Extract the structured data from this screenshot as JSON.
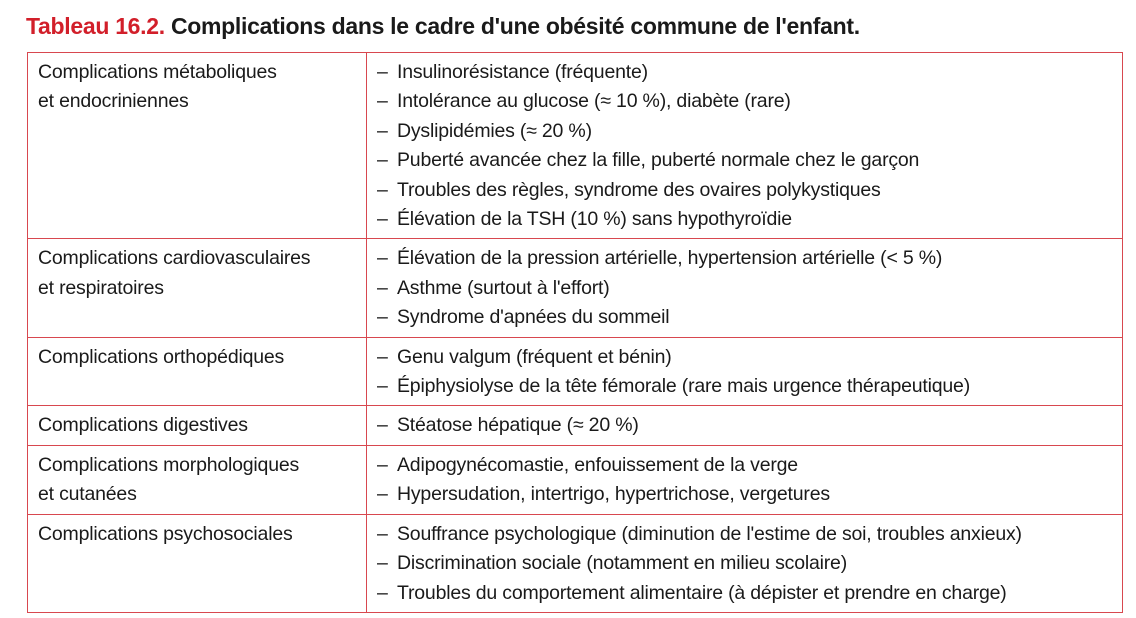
{
  "title": {
    "number": "Tableau 16.2.",
    "text": "Complications dans le cadre d'une obésité commune de l'enfant."
  },
  "bullet": "–",
  "colors": {
    "accent": "#d21f2a",
    "border": "#d8484f",
    "text": "#1a1a1a"
  },
  "rows": [
    {
      "category": [
        "Complications métaboliques",
        "et endocriniennes"
      ],
      "items": [
        "Insulinorésistance (fréquente)",
        "Intolérance au glucose (≈ 10 %), diabète (rare)",
        "Dyslipidémies (≈ 20 %)",
        "Puberté avancée chez la fille, puberté normale chez le garçon",
        "Troubles des règles, syndrome des ovaires polykystiques",
        "Élévation de la TSH (10 %) sans hypothyroïdie"
      ]
    },
    {
      "category": [
        "Complications cardiovasculaires",
        "et respiratoires"
      ],
      "items": [
        "Élévation de la pression artérielle, hypertension artérielle (< 5 %)",
        "Asthme (surtout à l'effort)",
        "Syndrome d'apnées du sommeil"
      ]
    },
    {
      "category": [
        "Complications orthopédiques"
      ],
      "items": [
        "Genu valgum (fréquent et bénin)",
        "Épiphysiolyse de la tête fémorale (rare mais urgence thérapeutique)"
      ]
    },
    {
      "category": [
        "Complications digestives"
      ],
      "items": [
        "Stéatose hépatique (≈ 20 %)"
      ]
    },
    {
      "category": [
        "Complications morphologiques",
        "et cutanées"
      ],
      "items": [
        "Adipogynécomastie, enfouissement de la verge",
        "Hypersudation, intertrigo, hypertrichose, vergetures"
      ]
    },
    {
      "category": [
        "Complications psychosociales"
      ],
      "items": [
        "Souffrance psychologique (diminution de l'estime de soi, troubles anxieux)",
        "Discrimination sociale (notamment en milieu scolaire)",
        "Troubles du comportement alimentaire (à dépister et prendre en charge)"
      ]
    }
  ]
}
